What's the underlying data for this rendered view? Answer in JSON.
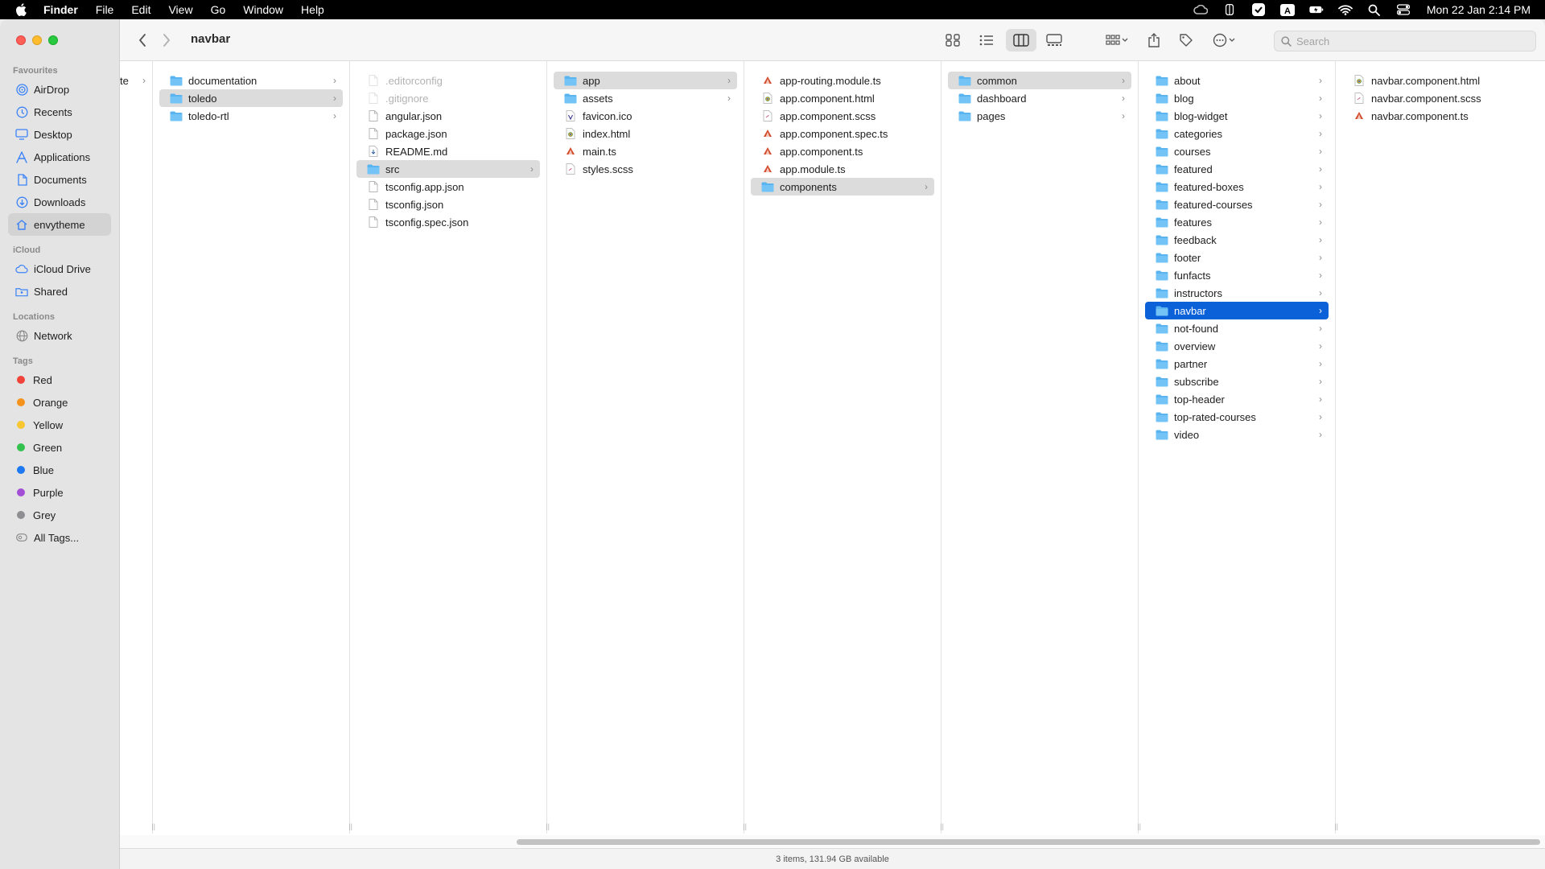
{
  "menubar": {
    "items": [
      "Finder",
      "File",
      "Edit",
      "View",
      "Go",
      "Window",
      "Help"
    ],
    "clock": "Mon 22 Jan  2:14 PM"
  },
  "toolbar": {
    "title": "navbar",
    "search_placeholder": "Search"
  },
  "sidebar": {
    "favourites_title": "Favourites",
    "favourites": [
      {
        "label": "AirDrop",
        "icon": "airdrop-icon"
      },
      {
        "label": "Recents",
        "icon": "clock-icon"
      },
      {
        "label": "Desktop",
        "icon": "desktop-icon"
      },
      {
        "label": "Applications",
        "icon": "applications-icon"
      },
      {
        "label": "Documents",
        "icon": "document-icon"
      },
      {
        "label": "Downloads",
        "icon": "download-icon"
      },
      {
        "label": "envytheme",
        "icon": "home-icon"
      }
    ],
    "icloud_title": "iCloud",
    "icloud": [
      {
        "label": "iCloud Drive",
        "icon": "cloud-icon"
      },
      {
        "label": "Shared",
        "icon": "shared-folder-icon"
      }
    ],
    "locations_title": "Locations",
    "locations": [
      {
        "label": "Network",
        "icon": "globe-icon"
      }
    ],
    "tags_title": "Tags",
    "tags": [
      {
        "label": "Red",
        "color": "#f0443a"
      },
      {
        "label": "Orange",
        "color": "#f5921b"
      },
      {
        "label": "Yellow",
        "color": "#f7c630"
      },
      {
        "label": "Green",
        "color": "#33c24d"
      },
      {
        "label": "Blue",
        "color": "#1e78f0"
      },
      {
        "label": "Purple",
        "color": "#a24fd6"
      },
      {
        "label": "Grey",
        "color": "#8e8e93"
      }
    ],
    "all_tags": "All Tags..."
  },
  "columns": {
    "c0": [
      {
        "name": "te",
        "folder": false
      }
    ],
    "c1": [
      {
        "name": "documentation"
      },
      {
        "name": "toledo"
      },
      {
        "name": "toledo-rtl"
      }
    ],
    "c2": [
      {
        "name": ".editorconfig"
      },
      {
        "name": ".gitignore"
      },
      {
        "name": "angular.json"
      },
      {
        "name": "package.json"
      },
      {
        "name": "README.md"
      },
      {
        "name": "src"
      },
      {
        "name": "tsconfig.app.json"
      },
      {
        "name": "tsconfig.json"
      },
      {
        "name": "tsconfig.spec.json"
      }
    ],
    "c3": [
      {
        "name": "app"
      },
      {
        "name": "assets"
      },
      {
        "name": "favicon.ico"
      },
      {
        "name": "index.html"
      },
      {
        "name": "main.ts"
      },
      {
        "name": "styles.scss"
      }
    ],
    "c4": [
      {
        "name": "app-routing.module.ts"
      },
      {
        "name": "app.component.html"
      },
      {
        "name": "app.component.scss"
      },
      {
        "name": "app.component.spec.ts"
      },
      {
        "name": "app.component.ts"
      },
      {
        "name": "app.module.ts"
      },
      {
        "name": "components"
      }
    ],
    "c5": [
      {
        "name": "common"
      },
      {
        "name": "dashboard"
      },
      {
        "name": "pages"
      }
    ],
    "c6": [
      {
        "name": "about"
      },
      {
        "name": "blog"
      },
      {
        "name": "blog-widget"
      },
      {
        "name": "categories"
      },
      {
        "name": "courses"
      },
      {
        "name": "featured"
      },
      {
        "name": "featured-boxes"
      },
      {
        "name": "featured-courses"
      },
      {
        "name": "features"
      },
      {
        "name": "feedback"
      },
      {
        "name": "footer"
      },
      {
        "name": "funfacts"
      },
      {
        "name": "instructors"
      },
      {
        "name": "navbar"
      },
      {
        "name": "not-found"
      },
      {
        "name": "overview"
      },
      {
        "name": "partner"
      },
      {
        "name": "subscribe"
      },
      {
        "name": "top-header"
      },
      {
        "name": "top-rated-courses"
      },
      {
        "name": "video"
      }
    ],
    "c7": [
      {
        "name": "navbar.component.html"
      },
      {
        "name": "navbar.component.scss"
      },
      {
        "name": "navbar.component.ts"
      }
    ]
  },
  "status": {
    "text": "3 items, 131.94 GB available"
  }
}
